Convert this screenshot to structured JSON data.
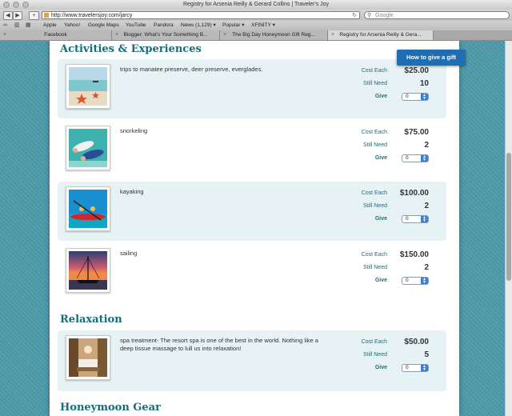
{
  "window": {
    "title": "Registry for Arsenia Reilly & Gerard Collins | Traveler's Joy"
  },
  "toolbar": {
    "url": "http://www.travelersjoy.com/jarcy",
    "search_placeholder": "Google"
  },
  "bookmarks": [
    "Apple",
    "Yahoo!",
    "Google Maps",
    "YouTube",
    "Pandora",
    "News (1,129) ▾",
    "Popular ▾",
    "XFINITY ▾"
  ],
  "tabs": [
    "Facebook",
    "Blogger: What's Your Something B...",
    "The Big Day Honeymoon Gift Reg...",
    "Registry for Arsenia Reilly & Gera..."
  ],
  "labels": {
    "cost_each": "Cost Each",
    "still_need": "Still Need",
    "give": "Give",
    "select_default": "0"
  },
  "howto_button": "How to give a gift",
  "sections": {
    "activities": "Activities & Experiences",
    "relaxation": "Relaxation",
    "gear": "Honeymoon Gear"
  },
  "items": [
    {
      "desc": "trips to manatee preserve, deer preserve, everglades.",
      "cost": "$25.00",
      "need": "10"
    },
    {
      "desc": "snorkeling",
      "cost": "$75.00",
      "need": "2"
    },
    {
      "desc": "kayaking",
      "cost": "$100.00",
      "need": "2"
    },
    {
      "desc": "sailing",
      "cost": "$150.00",
      "need": "2"
    },
    {
      "desc": "spa treatment- The resort spa is one of the best in the world. Nothing like a deep tissue massage to lull us into relaxation!",
      "cost": "$50.00",
      "need": "5"
    }
  ]
}
